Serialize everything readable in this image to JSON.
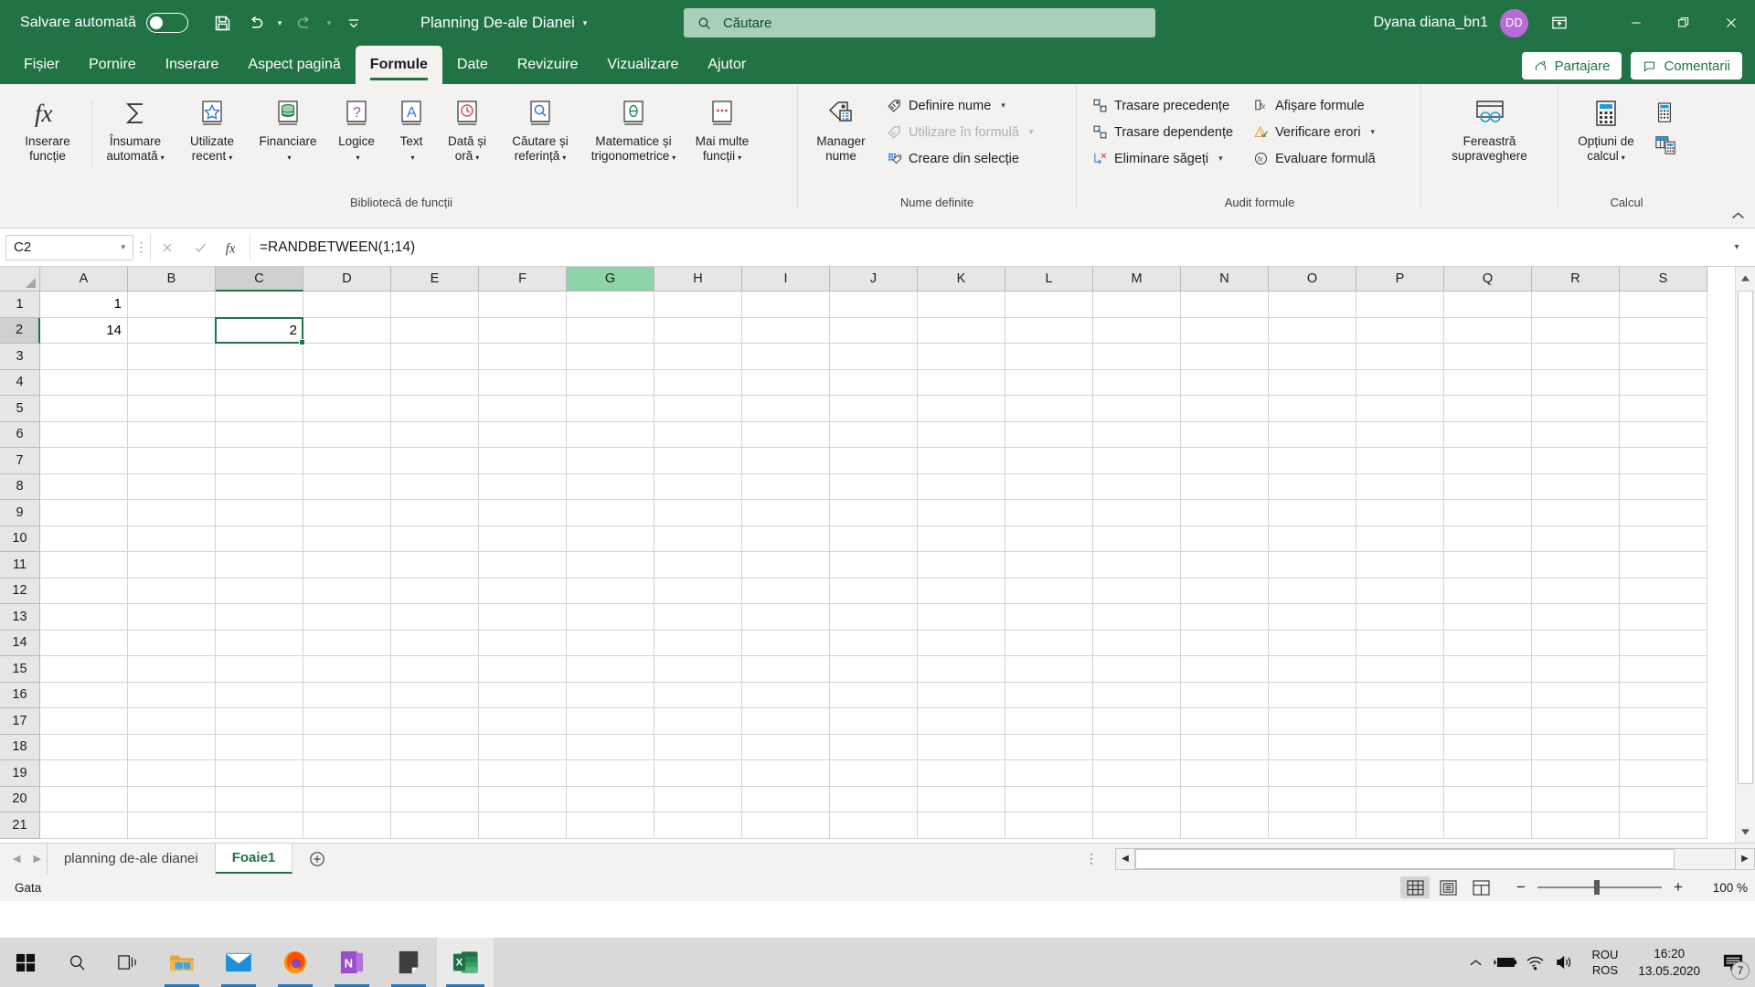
{
  "titlebar": {
    "autosave_label": "Salvare automată",
    "autosave_state": "off",
    "save_icon": "save-icon",
    "undo_icon": "undo-icon",
    "redo_icon": "redo-icon",
    "customize_qat_icon": "customize-quick-access-icon",
    "document_title": "Planning De-ale Dianei",
    "search_placeholder": "Căutare",
    "search_icon": "search-icon",
    "user_name": "Dyana diana_bn1",
    "user_initials": "DD",
    "ribbon_display_icon": "ribbon-display-options-icon",
    "minimize_icon": "minimize-icon",
    "restore_icon": "restore-icon",
    "close_icon": "close-icon",
    "accent_color": "#217346",
    "search_bg": "#a8cfb9",
    "avatar_color": "#bb6bd9"
  },
  "tabs": [
    {
      "label": "Fișier",
      "active": false
    },
    {
      "label": "Pornire",
      "active": false
    },
    {
      "label": "Inserare",
      "active": false
    },
    {
      "label": "Aspect pagină",
      "active": false
    },
    {
      "label": "Formule",
      "active": true
    },
    {
      "label": "Date",
      "active": false
    },
    {
      "label": "Revizuire",
      "active": false
    },
    {
      "label": "Vizualizare",
      "active": false
    },
    {
      "label": "Ajutor",
      "active": false
    }
  ],
  "tabstrip_right": {
    "share_label": "Partajare",
    "share_icon": "share-icon",
    "comments_label": "Comentarii",
    "comments_icon": "comment-icon"
  },
  "ribbon": {
    "groups": [
      {
        "name": "biblioteca-de-functii",
        "label": "Bibliotecă de funcții",
        "buttons": [
          {
            "label": "Inserare funcție",
            "icon": "insert-function-icon",
            "caret": false
          },
          {
            "label": "Însumare automată",
            "icon": "autosum-icon",
            "caret": true
          },
          {
            "label": "Utilizate recent",
            "icon": "recently-used-icon",
            "caret": true
          },
          {
            "label": "Financiare",
            "icon": "financial-icon",
            "caret": true
          },
          {
            "label": "Logice",
            "icon": "logical-icon",
            "caret": true
          },
          {
            "label": "Text",
            "icon": "text-functions-icon",
            "caret": true
          },
          {
            "label": "Dată și oră",
            "icon": "date-time-icon",
            "caret": true
          },
          {
            "label": "Căutare și referință",
            "icon": "lookup-reference-icon",
            "caret": true
          },
          {
            "label": "Matematice și trigonometrice",
            "icon": "math-trig-icon",
            "caret": true
          },
          {
            "label": "Mai multe funcții",
            "icon": "more-functions-icon",
            "caret": true
          }
        ]
      },
      {
        "name": "nume-definite",
        "label": "Nume definite",
        "big": {
          "label": "Manager nume",
          "icon": "name-manager-icon"
        },
        "items": [
          {
            "label": "Definire nume",
            "icon": "define-name-icon",
            "caret": true,
            "disabled": false
          },
          {
            "label": "Utilizare în formulă",
            "icon": "use-in-formula-icon",
            "caret": true,
            "disabled": true
          },
          {
            "label": "Creare din selecție",
            "icon": "create-from-selection-icon",
            "caret": false,
            "disabled": false
          }
        ]
      },
      {
        "name": "audit-formule",
        "label": "Audit formule",
        "col1": [
          {
            "label": "Trasare precedențe",
            "icon": "trace-precedents-icon",
            "caret": false
          },
          {
            "label": "Trasare dependențe",
            "icon": "trace-dependents-icon",
            "caret": false
          },
          {
            "label": "Eliminare săgeți",
            "icon": "remove-arrows-icon",
            "caret": true
          }
        ],
        "col2": [
          {
            "label": "Afișare formule",
            "icon": "show-formulas-icon",
            "caret": false
          },
          {
            "label": "Verificare erori",
            "icon": "error-checking-icon",
            "caret": true
          },
          {
            "label": "Evaluare formulă",
            "icon": "evaluate-formula-icon",
            "caret": false
          }
        ]
      },
      {
        "name": "fereastra-supraveghere",
        "label": "",
        "big": {
          "label": "Fereastră supraveghere",
          "icon": "watch-window-icon"
        }
      },
      {
        "name": "calcul",
        "label": "Calcul",
        "big": {
          "label": "Opțiuni de calcul",
          "icon": "calculation-options-icon",
          "caret": true
        },
        "small": [
          {
            "label": "",
            "icon": "calculate-now-icon"
          },
          {
            "label": "",
            "icon": "calculate-sheet-icon"
          }
        ]
      }
    ],
    "collapse_icon": "collapse-ribbon-icon"
  },
  "formulabar": {
    "name_box_value": "C2",
    "name_box_caret_icon": "chevron-down-icon",
    "cancel_icon": "cancel-icon",
    "enter_icon": "enter-icon",
    "fx_icon": "insert-function-icon",
    "formula_value": "=RANDBETWEEN(1;14)",
    "expand_icon": "expand-formula-bar-icon"
  },
  "grid": {
    "columns": [
      "A",
      "B",
      "C",
      "D",
      "E",
      "F",
      "G",
      "H",
      "I",
      "J",
      "K",
      "L",
      "M",
      "N",
      "O",
      "P",
      "Q",
      "R",
      "S"
    ],
    "selected_column": "C",
    "hovered_column": "G",
    "rows": [
      "1",
      "2",
      "3",
      "4",
      "5",
      "6",
      "7",
      "8",
      "9",
      "10",
      "11",
      "12",
      "13",
      "14",
      "15",
      "16",
      "17",
      "18",
      "19",
      "20",
      "21"
    ],
    "selected_row": "2",
    "cells": [
      {
        "ref": "A1",
        "col": 0,
        "row": 0,
        "value": "1"
      },
      {
        "ref": "A2",
        "col": 0,
        "row": 1,
        "value": "14"
      },
      {
        "ref": "C2",
        "col": 2,
        "row": 1,
        "value": "2"
      }
    ],
    "active_cell": "C2",
    "selection_color": "#217346"
  },
  "sheetbar": {
    "nav_first_icon": "nav-previous-icon",
    "nav_last_icon": "nav-next-icon",
    "sheets": [
      {
        "label": "planning de-ale dianei",
        "active": false
      },
      {
        "label": "Foaie1",
        "active": true
      }
    ],
    "add_sheet_icon": "add-sheet-icon",
    "more_icon": "sheet-options-icon",
    "hscroll_left_icon": "scroll-left-icon",
    "hscroll_right_icon": "scroll-right-icon"
  },
  "statusbar": {
    "status_text": "Gata",
    "views": [
      {
        "name": "normal-view",
        "icon": "normal-view-icon",
        "active": true
      },
      {
        "name": "page-layout-view",
        "icon": "page-layout-view-icon",
        "active": false
      },
      {
        "name": "page-break-view",
        "icon": "page-break-view-icon",
        "active": false
      }
    ],
    "zoom_out_label": "−",
    "zoom_in_label": "+",
    "zoom_level": "100 %"
  },
  "taskbar": {
    "items": [
      {
        "name": "start-button",
        "icon": "windows-start-icon",
        "open": false,
        "active": false
      },
      {
        "name": "search-button",
        "icon": "search-icon",
        "open": false,
        "active": false
      },
      {
        "name": "task-view-button",
        "icon": "task-view-icon",
        "open": false,
        "active": false
      },
      {
        "name": "file-explorer",
        "icon": "file-explorer-icon",
        "open": true,
        "active": false
      },
      {
        "name": "mail",
        "icon": "mail-icon",
        "open": true,
        "active": false
      },
      {
        "name": "firefox",
        "icon": "firefox-icon",
        "open": true,
        "active": false
      },
      {
        "name": "onenote",
        "icon": "onenote-icon",
        "open": true,
        "active": false
      },
      {
        "name": "sticky-notes",
        "icon": "sticky-notes-icon",
        "open": true,
        "active": false
      },
      {
        "name": "excel",
        "icon": "excel-icon",
        "open": true,
        "active": true
      }
    ],
    "tray": {
      "show_hidden_icon": "chevron-up-icon",
      "battery_icon": "battery-charging-icon",
      "wifi_icon": "wifi-icon",
      "volume_icon": "volume-icon",
      "lang_line1": "ROU",
      "lang_line2": "ROS",
      "time": "16:20",
      "date": "13.05.2020",
      "notifications_icon": "notifications-icon",
      "notifications_count": "7"
    }
  }
}
